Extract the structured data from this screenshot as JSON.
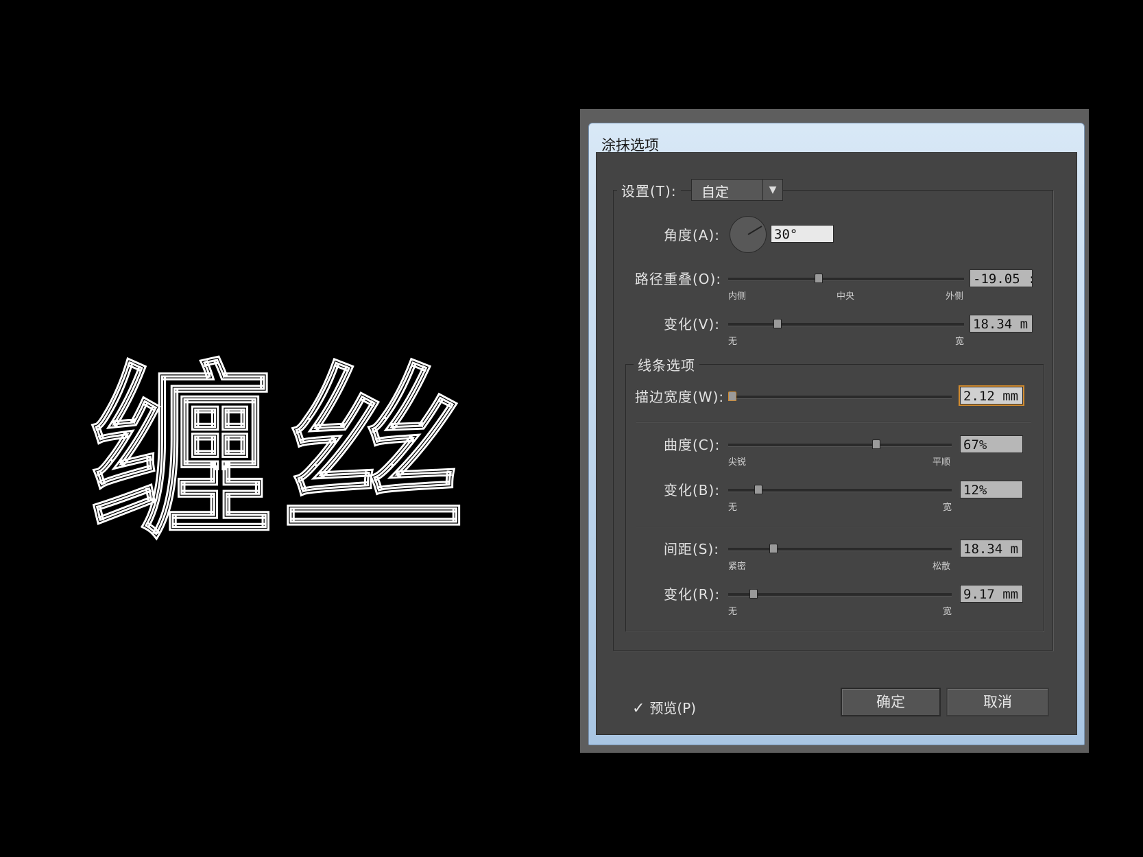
{
  "artwork": {
    "text": "缠丝"
  },
  "dialog": {
    "title": "涂抹选项",
    "setting": {
      "label": "设置(T):",
      "value": "自定"
    },
    "angle": {
      "label": "角度(A):",
      "value": "30°"
    },
    "path_overlap": {
      "label": "路径重叠(O):",
      "value": "-19.05 :",
      "level": 0.38,
      "ticks": [
        "内侧",
        "中央",
        "外侧"
      ]
    },
    "variation_v": {
      "label": "变化(V):",
      "value": "18.34 m",
      "level": 0.2,
      "ticks": [
        "无",
        "宽"
      ]
    },
    "line_options": {
      "legend": "线条选项",
      "stroke_width": {
        "label": "描边宽度(W):",
        "value": "2.12 mm",
        "level": 0.0
      },
      "curviness": {
        "label": "曲度(C):",
        "value": "67%",
        "level": 0.67,
        "ticks": [
          "尖锐",
          "平顺"
        ]
      },
      "variation_b": {
        "label": "变化(B):",
        "value": "12%",
        "level": 0.12,
        "ticks": [
          "无",
          "宽"
        ]
      },
      "spacing": {
        "label": "间距(S):",
        "value": "18.34 m",
        "level": 0.19,
        "ticks": [
          "紧密",
          "松散"
        ]
      },
      "variation_r": {
        "label": "变化(R):",
        "value": "9.17 mm",
        "level": 0.1,
        "ticks": [
          "无",
          "宽"
        ]
      }
    },
    "preview": {
      "label": "预览(P)",
      "checked": true
    },
    "ok_label": "确定",
    "cancel_label": "取消"
  }
}
